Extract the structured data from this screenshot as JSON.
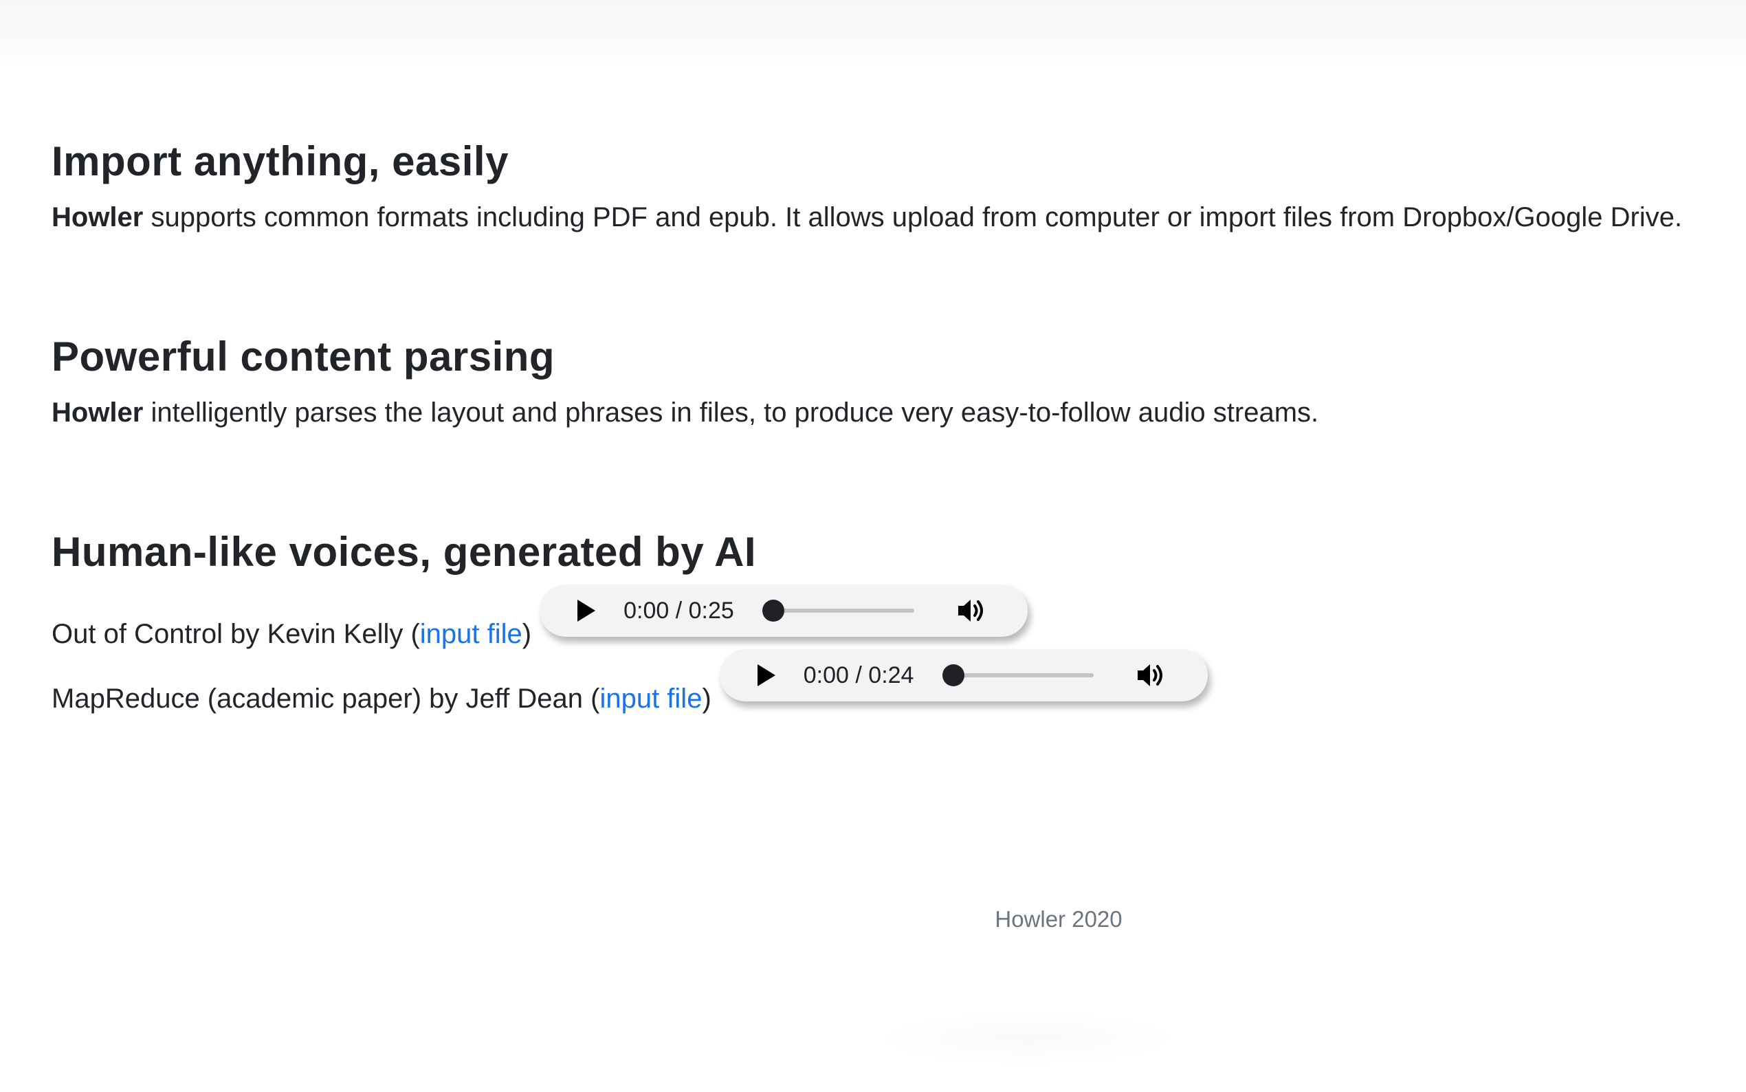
{
  "sections": [
    {
      "heading": "Import anything, easily",
      "brand": "Howler",
      "body": " supports common formats including PDF and epub. It allows upload from computer or import files from Dropbox/Google Drive."
    },
    {
      "heading": "Powerful content parsing",
      "brand": "Howler",
      "body": " intelligently parses the layout and phrases in files, to produce very easy-to-follow audio streams."
    },
    {
      "heading": "Human-like voices, generated by AI"
    }
  ],
  "samples": [
    {
      "title": "Out of Control by Kevin Kelly (",
      "link_label": "input file",
      "close": ")",
      "time": "0:00 / 0:25",
      "progress": 0.08
    },
    {
      "title": "MapReduce (academic paper) by Jeff Dean (",
      "link_label": "input file",
      "close": ")",
      "time": "0:00 / 0:24",
      "progress": 0.08
    }
  ],
  "icons": {
    "play": "play-icon",
    "volume": "volume-icon"
  },
  "colors": {
    "link": "#1a73e8",
    "text": "#212529",
    "footer": "#6c757d",
    "player_bg": "#f1f3f4"
  },
  "footer": {
    "text": "Howler 2020"
  }
}
